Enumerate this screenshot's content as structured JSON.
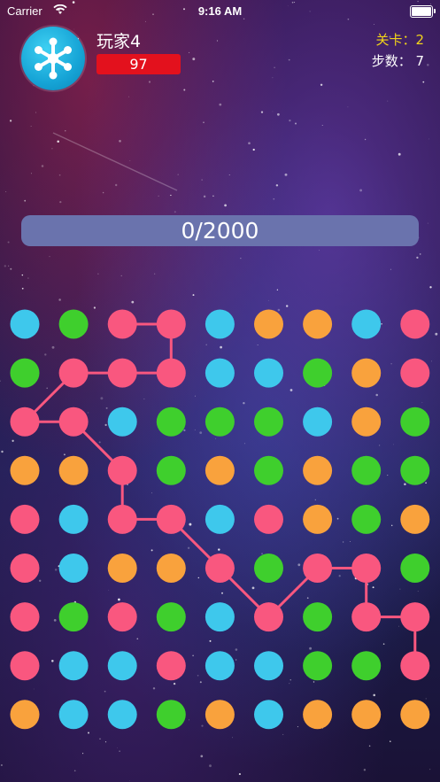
{
  "status_bar": {
    "carrier": "Carrier",
    "time": "9:16 AM"
  },
  "player": {
    "name": "玩家4",
    "score": "97",
    "avatar_icon": "network-hub-icon"
  },
  "stats": {
    "level": "关卡：2",
    "steps": "步数： 7"
  },
  "progress": {
    "text": "0/2000",
    "current": 0,
    "target": 2000
  },
  "colors": {
    "pink": "#f9577f",
    "green": "#3fcf2d",
    "blue": "#3ec8ec",
    "orange": "#f9a23d",
    "link": "#f9577f"
  },
  "board": {
    "rows": 9,
    "cols": 9,
    "grid": [
      [
        "blue",
        "green",
        "pink",
        "pink",
        "blue",
        "orange",
        "orange",
        "blue",
        "pink"
      ],
      [
        "green",
        "pink",
        "pink",
        "pink",
        "blue",
        "blue",
        "green",
        "orange",
        "pink"
      ],
      [
        "pink",
        "pink",
        "blue",
        "green",
        "green",
        "green",
        "blue",
        "orange",
        "green"
      ],
      [
        "orange",
        "orange",
        "pink",
        "green",
        "orange",
        "green",
        "orange",
        "green",
        "green"
      ],
      [
        "pink",
        "blue",
        "pink",
        "pink",
        "blue",
        "pink",
        "orange",
        "green",
        "orange"
      ],
      [
        "pink",
        "blue",
        "orange",
        "orange",
        "pink",
        "green",
        "pink",
        "pink",
        "green"
      ],
      [
        "pink",
        "green",
        "pink",
        "green",
        "blue",
        "pink",
        "green",
        "pink",
        "pink"
      ],
      [
        "pink",
        "blue",
        "blue",
        "pink",
        "blue",
        "blue",
        "green",
        "green",
        "pink"
      ],
      [
        "orange",
        "blue",
        "blue",
        "green",
        "orange",
        "blue",
        "orange",
        "orange",
        "orange"
      ]
    ],
    "path": [
      [
        0,
        2
      ],
      [
        0,
        3
      ],
      [
        1,
        3
      ],
      [
        1,
        2
      ],
      [
        1,
        1
      ],
      [
        2,
        0
      ],
      [
        2,
        1
      ],
      [
        3,
        2
      ],
      [
        4,
        2
      ],
      [
        4,
        3
      ],
      [
        5,
        4
      ],
      [
        6,
        5
      ],
      [
        5,
        6
      ],
      [
        5,
        7
      ],
      [
        6,
        7
      ],
      [
        6,
        8
      ],
      [
        7,
        8
      ]
    ]
  }
}
